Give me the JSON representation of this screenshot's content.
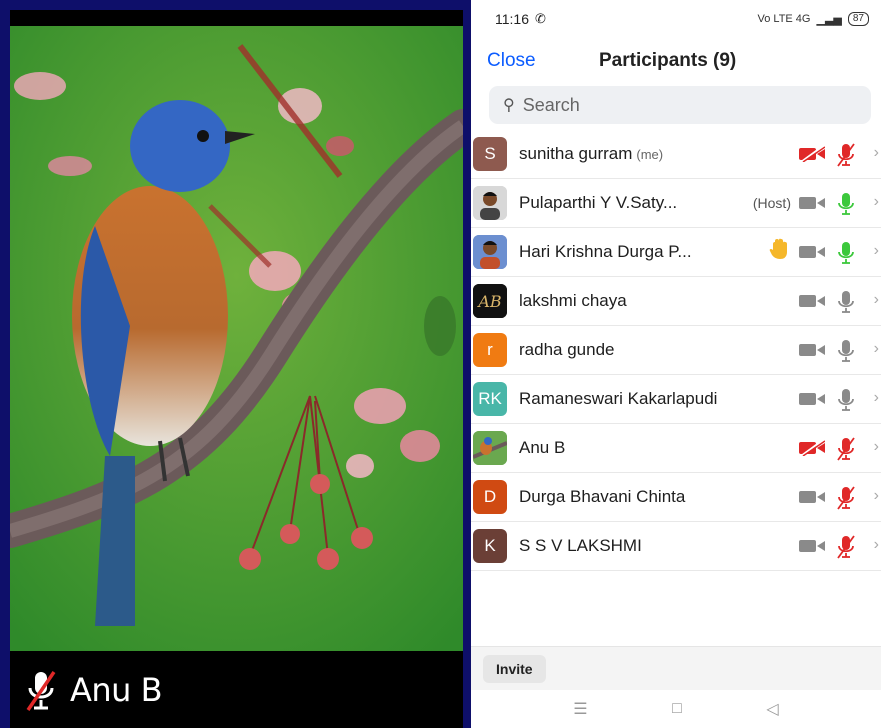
{
  "video": {
    "name": "Anu B",
    "muted": true
  },
  "status_bar": {
    "time": "11:16",
    "whatsapp_icon": "whatsapp-icon",
    "network_text": "Vo LTE 4G",
    "battery": "87"
  },
  "header": {
    "close_label": "Close",
    "title": "Participants (9)"
  },
  "search": {
    "placeholder": "Search"
  },
  "participants": [
    {
      "name": "sunitha gurram",
      "tag": "(me)",
      "initials": "S",
      "avatar_color": "#8e5a4f",
      "video_on": false,
      "mic_on": false
    },
    {
      "name": "Pulaparthi Y V.Saty...",
      "tag": "(Host)",
      "initials": "",
      "avatar_color": "#c8c8c8",
      "video_on": true,
      "mic_on": true
    },
    {
      "name": "Hari Krishna Durga P...",
      "tag": "",
      "initials": "",
      "avatar_color": "#5a7bbf",
      "video_on": true,
      "mic_on": true,
      "hand_raised": true
    },
    {
      "name": "lakshmi chaya",
      "tag": "",
      "initials": "",
      "avatar_color": "#111111",
      "video_on": true,
      "mic_on": "idle"
    },
    {
      "name": "radha gunde",
      "tag": "",
      "initials": "r",
      "avatar_color": "#f07b12",
      "video_on": true,
      "mic_on": "idle"
    },
    {
      "name": "Ramaneswari Kakarlapudi",
      "tag": "",
      "initials": "RK",
      "avatar_color": "#49b6a8",
      "video_on": true,
      "mic_on": "idle"
    },
    {
      "name": "Anu B",
      "tag": "",
      "initials": "",
      "avatar_color": "#6aa84f",
      "video_on": false,
      "mic_on": false
    },
    {
      "name": "Durga Bhavani Chinta",
      "tag": "",
      "initials": "D",
      "avatar_color": "#d04a12",
      "video_on": true,
      "mic_on": false
    },
    {
      "name": "S S V LAKSHMI",
      "tag": "",
      "initials": "K",
      "avatar_color": "#6b3f36",
      "video_on": true,
      "mic_on": false
    }
  ],
  "invite_label": "Invite",
  "colors": {
    "accent": "#0b5cff",
    "muted_red": "#e02828",
    "mic_green": "#3cc83c",
    "icon_gray": "#8a8a8a"
  },
  "nav_icons": [
    "menu-icon",
    "home-icon",
    "back-icon"
  ]
}
